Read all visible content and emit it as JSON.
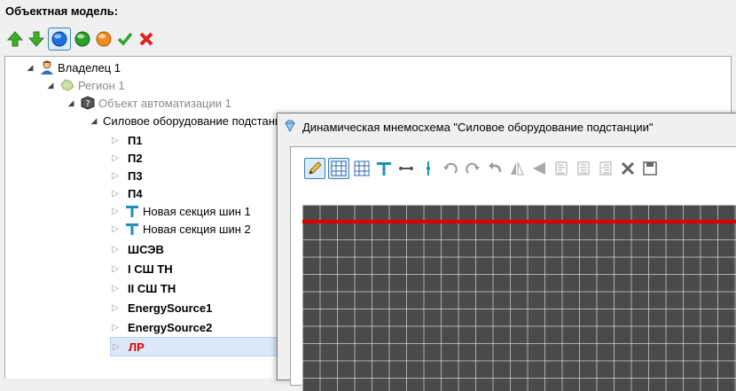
{
  "panel": {
    "title": "Объектная модель:"
  },
  "toolbar": {
    "buttons": [
      "up-arrow-icon",
      "down-arrow-icon",
      "blue-circle-icon",
      "green-circle-icon",
      "orange-circle-icon",
      "checkmark-icon",
      "cross-icon"
    ]
  },
  "tree": {
    "owner": "Владелец 1",
    "region": "Регион 1",
    "automation_object": "Объект автоматизации 1",
    "equipment": "Силовое оборудование подстанции",
    "children": [
      "П1",
      "П2",
      "П3",
      "П4",
      "Новая секция шин 1",
      "Новая секция шин 2",
      "ШСЭВ",
      "I СШ ТН",
      "II СШ ТН",
      "EnergySource1",
      "EnergySource2",
      "ЛР"
    ]
  },
  "dialog": {
    "title": "Динамическая мнемосхема \"Силовое оборудование подстанции\""
  },
  "colors": {
    "canvas_bg": "#4a4a4a",
    "busbar": "#e00000",
    "selected": "#e00000"
  }
}
